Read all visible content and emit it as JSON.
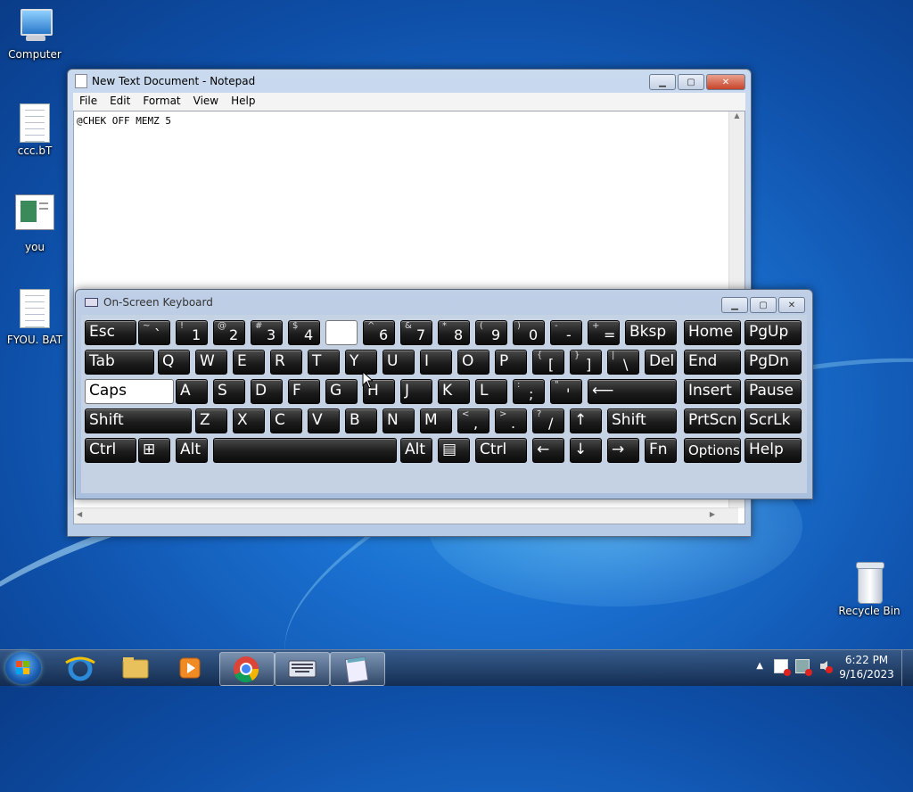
{
  "desktop": {
    "icons": [
      {
        "label": "Computer"
      },
      {
        "label": "ccc.bT"
      },
      {
        "label": "you"
      },
      {
        "label": "FYOU. BAT"
      },
      {
        "label": "Recycle Bin"
      }
    ]
  },
  "notepad": {
    "title": "New Text Document - Notepad",
    "menu": [
      "File",
      "Edit",
      "Format",
      "View",
      "Help"
    ],
    "content": "@CHEK OFF MEMZ 5"
  },
  "osk": {
    "title": "On-Screen Keyboard",
    "rows": [
      [
        [
          "Esc",
          ""
        ],
        [
          "`",
          "~"
        ],
        [
          "1",
          "!"
        ],
        [
          "2",
          "@"
        ],
        [
          "3",
          "#"
        ],
        [
          "4",
          "$"
        ],
        [
          "",
          ""
        ],
        [
          "6",
          "^"
        ],
        [
          "7",
          "&"
        ],
        [
          "8",
          "*"
        ],
        [
          "9",
          "("
        ],
        [
          "0",
          ")"
        ],
        [
          "-",
          "-"
        ],
        [
          "=",
          "+"
        ],
        [
          "Bksp",
          ""
        ],
        [
          "Home",
          ""
        ],
        [
          "PgUp",
          ""
        ]
      ],
      [
        [
          "Tab",
          ""
        ],
        [
          "Q",
          ""
        ],
        [
          "W",
          ""
        ],
        [
          "E",
          ""
        ],
        [
          "R",
          ""
        ],
        [
          "T",
          ""
        ],
        [
          "Y",
          ""
        ],
        [
          "U",
          ""
        ],
        [
          "I",
          ""
        ],
        [
          "O",
          ""
        ],
        [
          "P",
          ""
        ],
        [
          "[",
          "{"
        ],
        [
          "]",
          "}"
        ],
        [
          "\\",
          "|"
        ],
        [
          "Del",
          ""
        ],
        [
          "End",
          ""
        ],
        [
          "PgDn",
          ""
        ]
      ],
      [
        [
          "Caps",
          ""
        ],
        [
          "A",
          ""
        ],
        [
          "S",
          ""
        ],
        [
          "D",
          ""
        ],
        [
          "F",
          ""
        ],
        [
          "G",
          ""
        ],
        [
          "H",
          ""
        ],
        [
          "J",
          ""
        ],
        [
          "K",
          ""
        ],
        [
          "L",
          ""
        ],
        [
          ";",
          ":"
        ],
        [
          "'",
          "\""
        ],
        [
          "⟵",
          ""
        ],
        [
          "Insert",
          ""
        ],
        [
          "Pause",
          ""
        ]
      ],
      [
        [
          "Shift",
          ""
        ],
        [
          "Z",
          ""
        ],
        [
          "X",
          ""
        ],
        [
          "C",
          ""
        ],
        [
          "V",
          ""
        ],
        [
          "B",
          ""
        ],
        [
          "N",
          ""
        ],
        [
          "M",
          ""
        ],
        [
          ",",
          "<"
        ],
        [
          ".",
          ">"
        ],
        [
          "/",
          "?"
        ],
        [
          "↑",
          ""
        ],
        [
          "Shift",
          ""
        ],
        [
          "PrtScn",
          ""
        ],
        [
          "ScrLk",
          ""
        ]
      ],
      [
        [
          "Ctrl",
          ""
        ],
        [
          "⊞",
          ""
        ],
        [
          "Alt",
          ""
        ],
        [
          "",
          ""
        ],
        [
          "Alt",
          ""
        ],
        [
          "▤",
          ""
        ],
        [
          "Ctrl",
          ""
        ],
        [
          "←",
          ""
        ],
        [
          "↓",
          ""
        ],
        [
          "→",
          ""
        ],
        [
          "Fn",
          ""
        ],
        [
          "Options",
          ""
        ],
        [
          "Help",
          ""
        ]
      ]
    ]
  },
  "taskbar": {
    "time": "6:22 PM",
    "date": "9/16/2023"
  },
  "colors": {
    "accent": "#1a6fcf",
    "key": "#1c1c1c"
  }
}
